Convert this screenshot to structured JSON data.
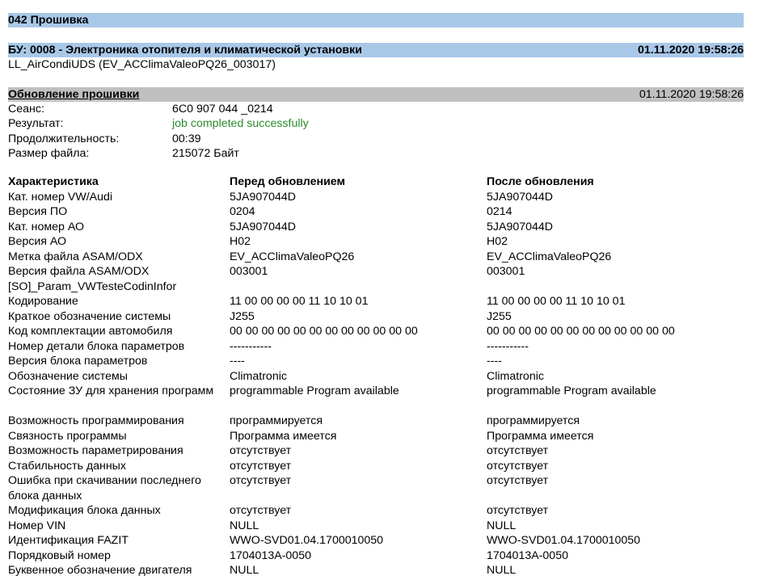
{
  "section_title": "042 Прошивка",
  "ecu": {
    "title": "БУ: 0008 - Электроника отопителя и климатической установки",
    "datetime": "01.11.2020 19:58:26",
    "subtitle": "LL_AirCondiUDS (EV_ACClimaValeoPQ26_003017)"
  },
  "update": {
    "title": "Обновление прошивки",
    "datetime": "01.11.2020 19:58:26",
    "fields": [
      {
        "label": "Сеанс:",
        "value": "6C0 907 044 _0214"
      },
      {
        "label": "Результат:",
        "value": "job completed successfully"
      },
      {
        "label": "Продолжительность:",
        "value": "00:39"
      },
      {
        "label": "Размер файла:",
        "value": "215072 Байт"
      }
    ]
  },
  "table": {
    "headers": [
      "Характеристика",
      "Перед обновлением",
      "После обновления"
    ],
    "rows": [
      [
        "Кат. номер VW/Audi",
        "5JA907044D",
        "5JA907044D"
      ],
      [
        "Версия ПО",
        "0204",
        "0214"
      ],
      [
        "Кат. номер АО",
        "5JA907044D",
        "5JA907044D"
      ],
      [
        "Версия АО",
        "H02",
        "H02"
      ],
      [
        "Метка файла ASAM/ODX",
        "EV_ACClimaValeoPQ26",
        "EV_ACClimaValeoPQ26"
      ],
      [
        "Версия файла ASAM/ODX",
        "003001",
        "003001"
      ],
      [
        "[SO]_Param_VWTesteCodinInfor",
        "",
        ""
      ],
      [
        "Кодирование",
        "11 00 00 00 00 11 10 10 01",
        "11 00 00 00 00 11 10 10 01"
      ],
      [
        "Краткое обозначение системы",
        "J255",
        "J255"
      ],
      [
        "Код комплектации автомобиля",
        "00 00 00 00 00 00 00 00 00 00 00 00",
        "00 00 00 00 00 00 00 00 00 00 00 00"
      ],
      [
        "Номер детали блока параметров",
        "-----------",
        "-----------"
      ],
      [
        "Версия блока параметров",
        "----",
        "----"
      ],
      [
        "Обозначение системы",
        "Climatronic",
        "Climatronic"
      ],
      [
        "Состояние ЗУ для хранения программ",
        "programmable Program available",
        "programmable Program available"
      ],
      [
        "Возможность программирования",
        "программируется",
        "программируется"
      ],
      [
        "Связность программы",
        "Программа имеется",
        "Программа имеется"
      ],
      [
        "Возможность параметрирования",
        "отсутствует",
        "отсутствует"
      ],
      [
        "Стабильность данных",
        "отсутствует",
        "отсутствует"
      ],
      [
        "Ошибка при скачивании последнего блока данных",
        "отсутствует",
        "отсутствует"
      ],
      [
        "Модификация блока данных",
        "отсутствует",
        "отсутствует"
      ],
      [
        "Номер VIN",
        "NULL",
        "NULL"
      ],
      [
        "Идентификация FAZIT",
        "WWO-SVD01.04.1700010050",
        "WWO-SVD01.04.1700010050"
      ],
      [
        "Порядковый номер",
        "1704013A-0050",
        "1704013A-0050"
      ],
      [
        "Буквенное обозначение двигателя",
        "NULL",
        "NULL"
      ]
    ]
  },
  "colors": {
    "header_bar": "#a9c8e8",
    "section_bar": "#c0c0c0",
    "success_text": "#2a8a2a"
  }
}
